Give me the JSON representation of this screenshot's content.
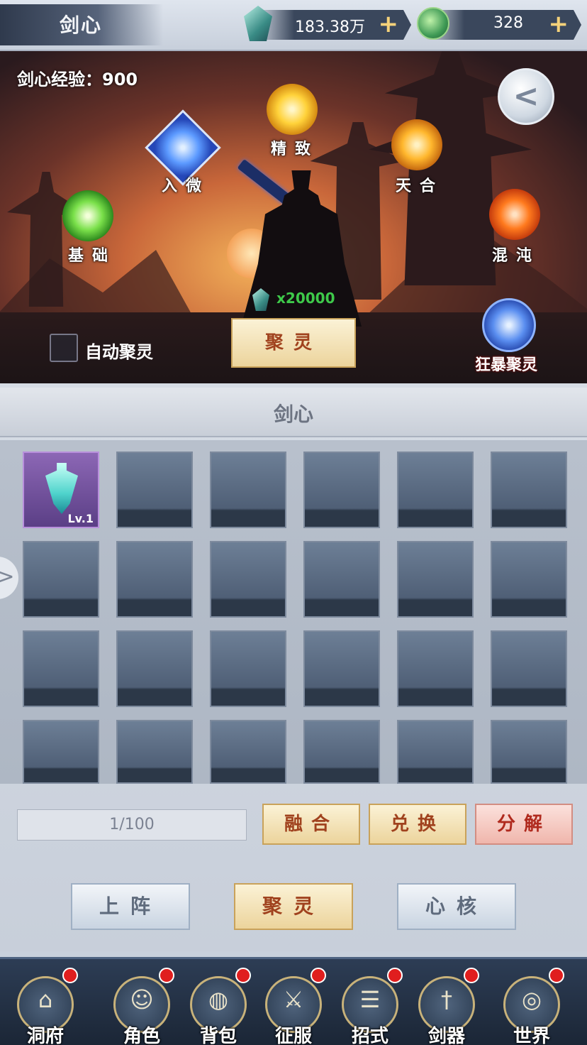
{
  "header": {
    "title": "剑心",
    "gems_value": "183.38万",
    "jade_value": "328",
    "plus_symbol": "+"
  },
  "scene": {
    "exp_text": "剑心经验：900",
    "orbs": {
      "jichu": "基础",
      "ruwei": "入微",
      "jingzhi": "精致",
      "tianhe": "天合",
      "hundun": "混沌"
    },
    "cost_value": "x20000",
    "auto_gather_label": "自动聚灵",
    "gather_button": "聚灵",
    "frenzy_gather_label": "狂暴聚灵",
    "back_glyph": "<"
  },
  "panel": {
    "title": "剑心",
    "items": [
      {
        "level": "Lv.1"
      }
    ],
    "capacity": "1/100",
    "actions": {
      "fuse": "融合",
      "exchange": "兑换",
      "decompose": "分解"
    },
    "tabs": {
      "deploy": "上阵",
      "gather": "聚灵",
      "core": "心核"
    },
    "side_arrow": ">"
  },
  "nav": {
    "items": [
      {
        "label": "洞府",
        "icon": "cave-house-icon",
        "glyph": "⌂"
      },
      {
        "label": "角色",
        "icon": "character-icon",
        "glyph": "☺"
      },
      {
        "label": "背包",
        "icon": "bag-icon",
        "glyph": "◍"
      },
      {
        "label": "征服",
        "icon": "crossed-swords-icon",
        "glyph": "⚔"
      },
      {
        "label": "招式",
        "icon": "scroll-book-icon",
        "glyph": "☰"
      },
      {
        "label": "剑器",
        "icon": "sword-weapon-icon",
        "glyph": "†"
      },
      {
        "label": "世界",
        "icon": "world-map-icon",
        "glyph": "◎"
      }
    ]
  },
  "colors": {
    "gold_button_text": "#a0421e",
    "red_button_text": "#b02a1e",
    "cost_green": "#3ec94a",
    "notification_red": "#e01e1e"
  }
}
